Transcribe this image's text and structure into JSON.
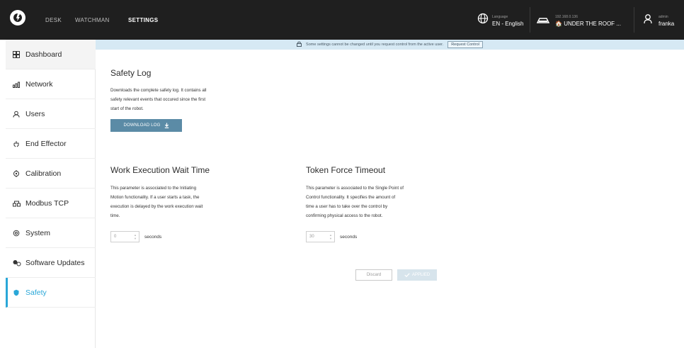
{
  "topbar": {
    "nav": [
      "DESK",
      "WATCHMAN",
      "SETTINGS"
    ],
    "language_label": "Language",
    "language_value": "EN - English",
    "ip": "192.168.0.136",
    "location": "UNDER THE ROOF ...",
    "user_role": "admin",
    "user_name": "franka"
  },
  "notice": {
    "text": "Some settings cannot be changed until you request control from the active user.",
    "button": "Request Control"
  },
  "sidebar": {
    "items": [
      {
        "label": "Dashboard",
        "icon": "dashboard-icon"
      },
      {
        "label": "Network",
        "icon": "network-icon"
      },
      {
        "label": "Users",
        "icon": "users-icon"
      },
      {
        "label": "End Effector",
        "icon": "end-effector-icon"
      },
      {
        "label": "Calibration",
        "icon": "calibration-icon"
      },
      {
        "label": "Modbus TCP",
        "icon": "modbus-icon"
      },
      {
        "label": "System",
        "icon": "system-icon"
      },
      {
        "label": "Software Updates",
        "icon": "software-updates-icon"
      },
      {
        "label": "Safety",
        "icon": "safety-icon"
      }
    ]
  },
  "safety_log": {
    "title": "Safety Log",
    "line1": "Downloads the complete safety log. It contains all",
    "line2": "safety relevant events that occured since the first",
    "line3": "start of the robot.",
    "button": "DOWNLOAD LOG"
  },
  "work_exec": {
    "title": "Work Execution Wait Time",
    "line1": "This parameter is associated to the Initiating",
    "line2": "Motion functionality. If a user starts a task, the",
    "line3": "execution is delayed by the work execution wait",
    "line4": "time.",
    "value": "0",
    "unit": "seconds"
  },
  "token_force": {
    "title": "Token Force Timeout",
    "line1": "This parameter is associated to the Single Point of",
    "line2": "Control functionality. It specifies the amount of",
    "line3": "time a user has to take over the control by",
    "line4": "confirming physical access to the robot.",
    "value": "30",
    "unit": "seconds"
  },
  "actions": {
    "discard": "Discard",
    "applied": "APPLIED"
  },
  "colors": {
    "accent": "#29a7d8",
    "topbar": "#1f1f1f",
    "notice_bg": "#d6e9f4",
    "download_button": "#5b8ba6"
  }
}
